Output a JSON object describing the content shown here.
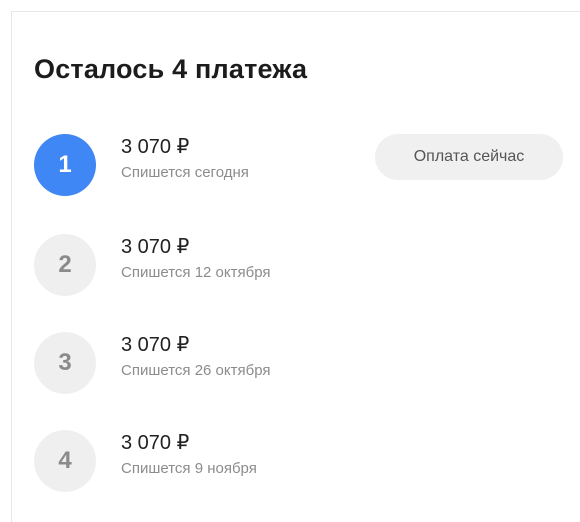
{
  "header": {
    "title": "Осталось 4 платежа"
  },
  "payments": [
    {
      "number": "1",
      "amount": "3 070 ₽",
      "note": "Спишется сегодня",
      "active": true
    },
    {
      "number": "2",
      "amount": "3 070 ₽",
      "note": "Спишется 12 октября",
      "active": false
    },
    {
      "number": "3",
      "amount": "3 070 ₽",
      "note": "Спишется 26 октября",
      "active": false
    },
    {
      "number": "4",
      "amount": "3 070 ₽",
      "note": "Спишется 9 ноября",
      "active": false
    }
  ],
  "actions": {
    "pay_now_label": "Оплата сейчас"
  },
  "colors": {
    "accent": "#3f87f5",
    "inactive_circle": "#efefef",
    "pill_background": "#f0f0f0"
  }
}
